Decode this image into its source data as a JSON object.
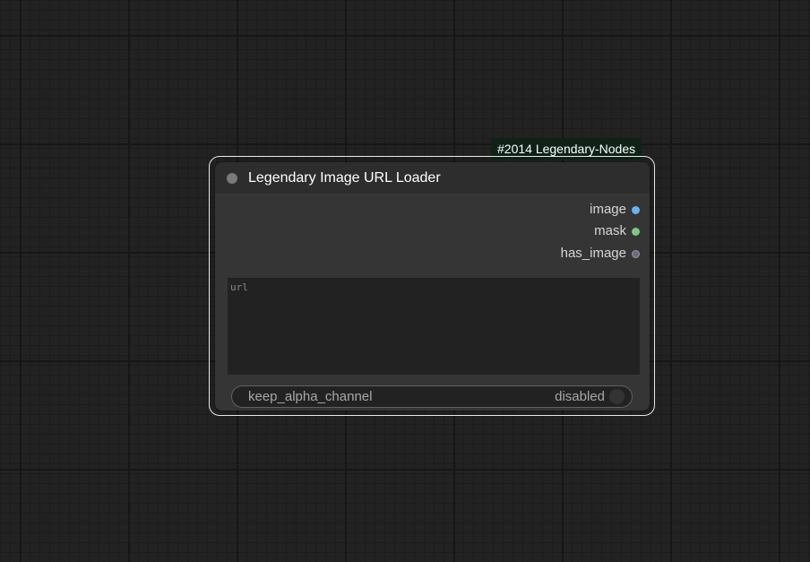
{
  "node": {
    "badge": "#2014 Legendary-Nodes",
    "title": "Legendary Image URL Loader",
    "outputs": [
      {
        "label": "image",
        "color": "#64b5f6"
      },
      {
        "label": "mask",
        "color": "#81c784"
      },
      {
        "label": "has_image",
        "color": "#6e6a7e"
      }
    ],
    "url_widget": {
      "placeholder": "url",
      "value": ""
    },
    "toggle": {
      "label": "keep_alpha_channel",
      "value": "disabled"
    }
  },
  "colors": {
    "canvas_background": "#222222",
    "node_body": "#353535",
    "node_header": "#2d2d2d",
    "badge_background": "#0e2218",
    "selection_outline": "#e8e8e8"
  }
}
